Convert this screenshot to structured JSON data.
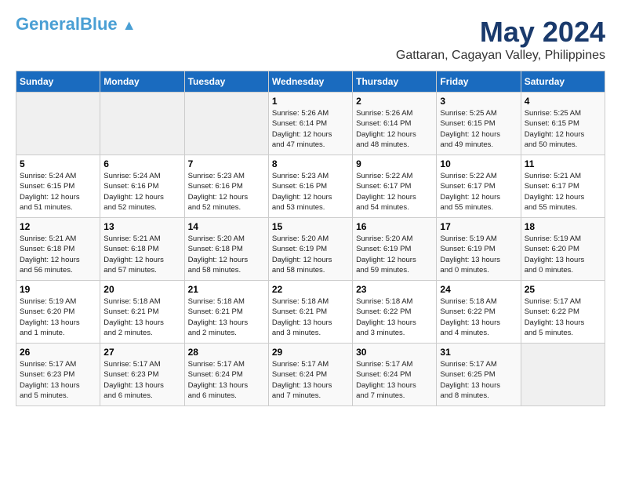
{
  "header": {
    "logo_general": "General",
    "logo_blue": "Blue",
    "title": "May 2024",
    "subtitle": "Gattaran, Cagayan Valley, Philippines"
  },
  "days_of_week": [
    "Sunday",
    "Monday",
    "Tuesday",
    "Wednesday",
    "Thursday",
    "Friday",
    "Saturday"
  ],
  "weeks": [
    [
      {
        "day": "",
        "info": ""
      },
      {
        "day": "",
        "info": ""
      },
      {
        "day": "",
        "info": ""
      },
      {
        "day": "1",
        "info": "Sunrise: 5:26 AM\nSunset: 6:14 PM\nDaylight: 12 hours\nand 47 minutes."
      },
      {
        "day": "2",
        "info": "Sunrise: 5:26 AM\nSunset: 6:14 PM\nDaylight: 12 hours\nand 48 minutes."
      },
      {
        "day": "3",
        "info": "Sunrise: 5:25 AM\nSunset: 6:15 PM\nDaylight: 12 hours\nand 49 minutes."
      },
      {
        "day": "4",
        "info": "Sunrise: 5:25 AM\nSunset: 6:15 PM\nDaylight: 12 hours\nand 50 minutes."
      }
    ],
    [
      {
        "day": "5",
        "info": "Sunrise: 5:24 AM\nSunset: 6:15 PM\nDaylight: 12 hours\nand 51 minutes."
      },
      {
        "day": "6",
        "info": "Sunrise: 5:24 AM\nSunset: 6:16 PM\nDaylight: 12 hours\nand 52 minutes."
      },
      {
        "day": "7",
        "info": "Sunrise: 5:23 AM\nSunset: 6:16 PM\nDaylight: 12 hours\nand 52 minutes."
      },
      {
        "day": "8",
        "info": "Sunrise: 5:23 AM\nSunset: 6:16 PM\nDaylight: 12 hours\nand 53 minutes."
      },
      {
        "day": "9",
        "info": "Sunrise: 5:22 AM\nSunset: 6:17 PM\nDaylight: 12 hours\nand 54 minutes."
      },
      {
        "day": "10",
        "info": "Sunrise: 5:22 AM\nSunset: 6:17 PM\nDaylight: 12 hours\nand 55 minutes."
      },
      {
        "day": "11",
        "info": "Sunrise: 5:21 AM\nSunset: 6:17 PM\nDaylight: 12 hours\nand 55 minutes."
      }
    ],
    [
      {
        "day": "12",
        "info": "Sunrise: 5:21 AM\nSunset: 6:18 PM\nDaylight: 12 hours\nand 56 minutes."
      },
      {
        "day": "13",
        "info": "Sunrise: 5:21 AM\nSunset: 6:18 PM\nDaylight: 12 hours\nand 57 minutes."
      },
      {
        "day": "14",
        "info": "Sunrise: 5:20 AM\nSunset: 6:18 PM\nDaylight: 12 hours\nand 58 minutes."
      },
      {
        "day": "15",
        "info": "Sunrise: 5:20 AM\nSunset: 6:19 PM\nDaylight: 12 hours\nand 58 minutes."
      },
      {
        "day": "16",
        "info": "Sunrise: 5:20 AM\nSunset: 6:19 PM\nDaylight: 12 hours\nand 59 minutes."
      },
      {
        "day": "17",
        "info": "Sunrise: 5:19 AM\nSunset: 6:19 PM\nDaylight: 13 hours\nand 0 minutes."
      },
      {
        "day": "18",
        "info": "Sunrise: 5:19 AM\nSunset: 6:20 PM\nDaylight: 13 hours\nand 0 minutes."
      }
    ],
    [
      {
        "day": "19",
        "info": "Sunrise: 5:19 AM\nSunset: 6:20 PM\nDaylight: 13 hours\nand 1 minute."
      },
      {
        "day": "20",
        "info": "Sunrise: 5:18 AM\nSunset: 6:21 PM\nDaylight: 13 hours\nand 2 minutes."
      },
      {
        "day": "21",
        "info": "Sunrise: 5:18 AM\nSunset: 6:21 PM\nDaylight: 13 hours\nand 2 minutes."
      },
      {
        "day": "22",
        "info": "Sunrise: 5:18 AM\nSunset: 6:21 PM\nDaylight: 13 hours\nand 3 minutes."
      },
      {
        "day": "23",
        "info": "Sunrise: 5:18 AM\nSunset: 6:22 PM\nDaylight: 13 hours\nand 3 minutes."
      },
      {
        "day": "24",
        "info": "Sunrise: 5:18 AM\nSunset: 6:22 PM\nDaylight: 13 hours\nand 4 minutes."
      },
      {
        "day": "25",
        "info": "Sunrise: 5:17 AM\nSunset: 6:22 PM\nDaylight: 13 hours\nand 5 minutes."
      }
    ],
    [
      {
        "day": "26",
        "info": "Sunrise: 5:17 AM\nSunset: 6:23 PM\nDaylight: 13 hours\nand 5 minutes."
      },
      {
        "day": "27",
        "info": "Sunrise: 5:17 AM\nSunset: 6:23 PM\nDaylight: 13 hours\nand 6 minutes."
      },
      {
        "day": "28",
        "info": "Sunrise: 5:17 AM\nSunset: 6:24 PM\nDaylight: 13 hours\nand 6 minutes."
      },
      {
        "day": "29",
        "info": "Sunrise: 5:17 AM\nSunset: 6:24 PM\nDaylight: 13 hours\nand 7 minutes."
      },
      {
        "day": "30",
        "info": "Sunrise: 5:17 AM\nSunset: 6:24 PM\nDaylight: 13 hours\nand 7 minutes."
      },
      {
        "day": "31",
        "info": "Sunrise: 5:17 AM\nSunset: 6:25 PM\nDaylight: 13 hours\nand 8 minutes."
      },
      {
        "day": "",
        "info": ""
      }
    ]
  ]
}
